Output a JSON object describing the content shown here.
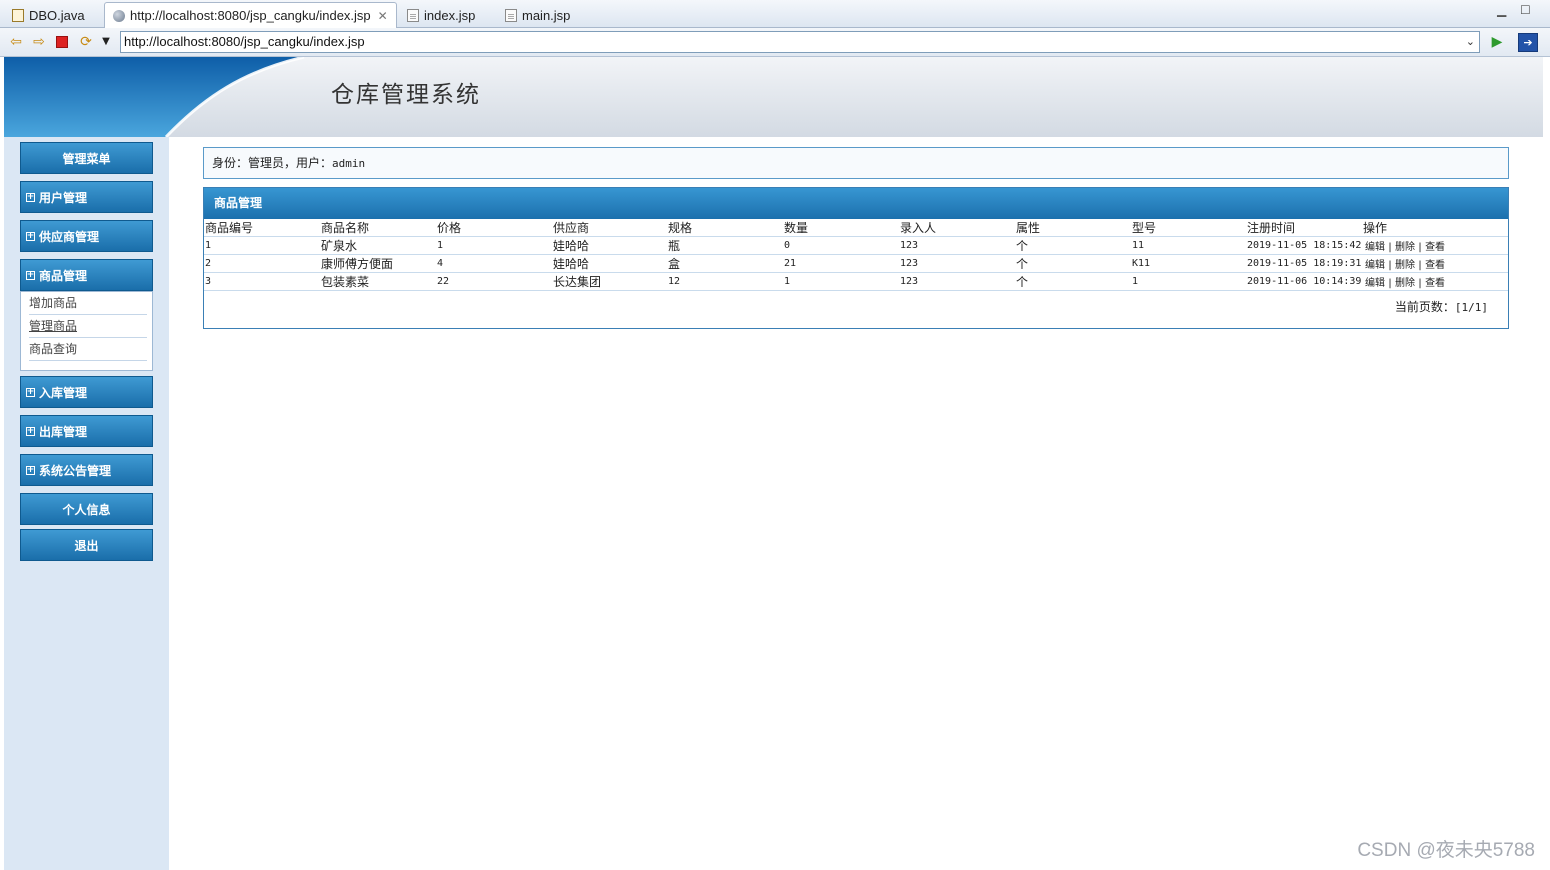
{
  "browser": {
    "tabs": [
      {
        "label": "DBO.java"
      },
      {
        "label": "http://localhost:8080/jsp_cangku/index.jsp"
      },
      {
        "label": "index.jsp"
      },
      {
        "label": "main.jsp"
      }
    ],
    "address": "http://localhost:8080/jsp_cangku/index.jsp"
  },
  "header": {
    "title": "仓库管理系统"
  },
  "sidebar": {
    "menu_title": "管理菜单",
    "items": [
      {
        "label": "用户管理"
      },
      {
        "label": "供应商管理"
      },
      {
        "label": "商品管理"
      },
      {
        "label": "入库管理"
      },
      {
        "label": "出库管理"
      },
      {
        "label": "系统公告管理"
      }
    ],
    "sub_items": [
      {
        "label": "增加商品"
      },
      {
        "label": "管理商品"
      },
      {
        "label": "商品查询"
      }
    ],
    "profile": "个人信息",
    "logout": "退出"
  },
  "identity": {
    "text": "身份：管理员，用户：",
    "user": "admin"
  },
  "goods": {
    "title": "商品管理",
    "columns": [
      "商品编号",
      "商品名称",
      "价格",
      "供应商",
      "规格",
      "数量",
      "录入人",
      "属性",
      "型号",
      "注册时间",
      "操作"
    ],
    "rows": [
      {
        "id": "1",
        "name": "矿泉水",
        "price": "1",
        "supplier": "娃哈哈",
        "spec": "瓶",
        "qty": "0",
        "entry": "123",
        "attr": "个",
        "model": "11",
        "time": "2019-11-05 18:15:42"
      },
      {
        "id": "2",
        "name": "康师傅方便面",
        "price": "4",
        "supplier": "娃哈哈",
        "spec": "盒",
        "qty": "21",
        "entry": "123",
        "attr": "个",
        "model": "K11",
        "time": "2019-11-05 18:19:31"
      },
      {
        "id": "3",
        "name": "包装素菜",
        "price": "22",
        "supplier": "长达集团",
        "spec": "12",
        "qty": "1",
        "entry": "123",
        "attr": "个",
        "model": "1",
        "time": "2019-11-06 10:14:39"
      }
    ],
    "ops": {
      "edit": "编辑",
      "delete": "删除",
      "view": "查看"
    },
    "pager_label": "当前页数：",
    "pager_value": "[1/1]"
  },
  "watermark": "CSDN @夜未央5788",
  "colors": {
    "accent": "#1c70ad",
    "sidebar_bg": "#dbe7f4",
    "border": "#5a9ac9"
  }
}
